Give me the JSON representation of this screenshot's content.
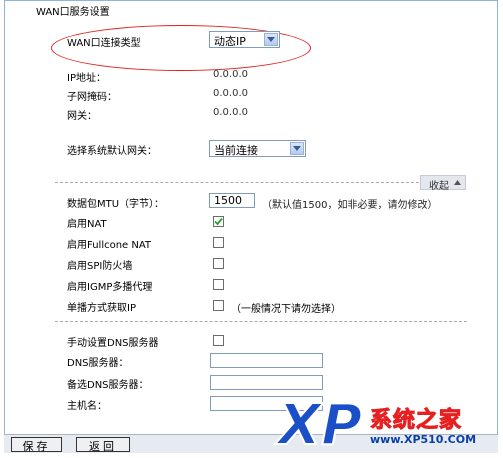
{
  "section": {
    "title": "WAN口服务设置"
  },
  "wan_type": {
    "label": "WAN口连接类型",
    "value": "动态IP"
  },
  "ip_info": {
    "ip_label": "IP地址：",
    "ip_value": "0.0.0.0",
    "mask_label": "子网掩码：",
    "mask_value": "0.0.0.0",
    "gateway_label": "网关：",
    "gateway_value": "0.0.0.0"
  },
  "default_gateway": {
    "label": "选择系统默认网关：",
    "value": "当前连接"
  },
  "collapse": {
    "label": "收起"
  },
  "mtu": {
    "label": "数据包MTU（字节）：",
    "value": "1500",
    "hint": "（默认值1500，如非必要，请勿修改）"
  },
  "options": {
    "nat_label": "启用NAT",
    "nat_checked": true,
    "fullcone_label": "启用Fullcone NAT",
    "fullcone_checked": false,
    "spi_label": "启用SPI防火墙",
    "spi_checked": false,
    "igmp_label": "启用IGMP多播代理",
    "igmp_checked": false,
    "unicast_label": "单播方式获取IP",
    "unicast_checked": false,
    "unicast_hint": "（一般情况下请勿选择）"
  },
  "dns": {
    "manual_label": "手动设置DNS服务器",
    "manual_checked": false,
    "primary_label": "DNS服务器：",
    "primary_value": "",
    "secondary_label": "备选DNS服务器：",
    "secondary_value": "",
    "hostname_label": "主机名：",
    "hostname_value": ""
  },
  "buttons": {
    "save": "保存",
    "back": "返回"
  },
  "watermark": {
    "brand": "XP",
    "text": "系统之家",
    "url": "www.XP510.COM"
  },
  "colors": {
    "annotation_ellipse": "#e02020",
    "checkmark": "#2aa12a",
    "watermark_brand_blue": "#1a4fc8",
    "watermark_text_red": "#e62020"
  }
}
